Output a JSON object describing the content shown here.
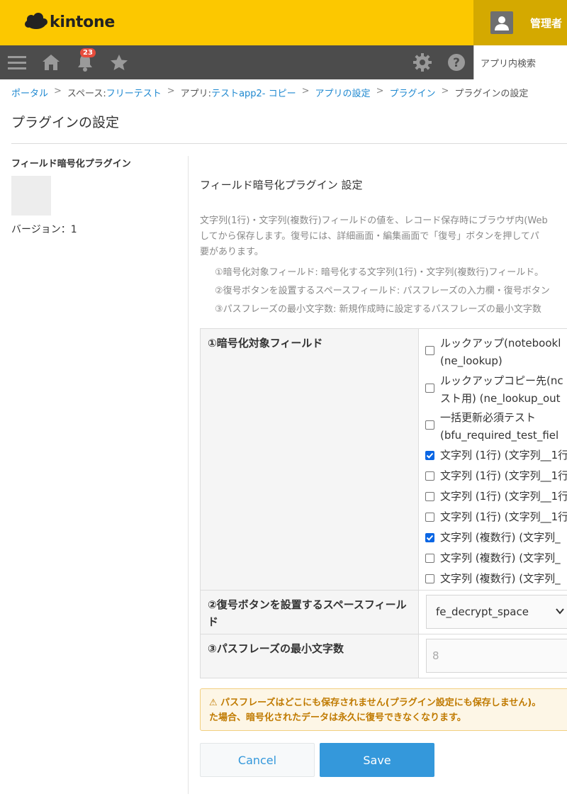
{
  "header": {
    "logo_text": "kintone",
    "user_name": "管理者"
  },
  "nav": {
    "notification_count": "23",
    "search_placeholder": "アプリ内検索"
  },
  "breadcrumb": {
    "portal": "ポータル",
    "space_prefix": "スペース: ",
    "space": "フリーテスト",
    "app_prefix": "アプリ: ",
    "app": "テストapp2- コピー",
    "app_settings": "アプリの設定",
    "plugins": "プラグイン",
    "current": "プラグインの設定",
    "separator": ">"
  },
  "page_title": "プラグインの設定",
  "plugin": {
    "name": "フィールド暗号化プラグイン",
    "version": "バージョン：1"
  },
  "settings": {
    "title": "フィールド暗号化プラグイン 設定",
    "description": [
      "文字列(1行)・文字列(複数行)フィールドの値を、レコード保存時にブラウザ内(Web",
      "してから保存します。復号には、詳細画面・編集画面で「復号」ボタンを押してパ",
      "要があります。"
    ],
    "items": [
      "①暗号化対象フィールド: 暗号化する文字列(1行)・文字列(複数行)フィールド。",
      "②復号ボタンを設置するスペースフィールド: パスフレーズの入力欄・復号ボタン",
      "③パスフレーズの最小文字数: 新規作成時に設定するパスフレーズの最小文字数"
    ]
  },
  "form": {
    "target_fields_label": "①暗号化対象フィールド",
    "fields": [
      {
        "line1": "ルックアップ(notebookl",
        "line2": "(ne_lookup)",
        "checked": false
      },
      {
        "line1": "ルックアップコピー先(nc",
        "line2": "スト用) (ne_lookup_out",
        "checked": false
      },
      {
        "line1": "一括更新必須テスト",
        "line2": "(bfu_required_test_fiel",
        "checked": false
      },
      {
        "line1": "文字列 (1行) (文字列__1行",
        "line2": "",
        "checked": true
      },
      {
        "line1": "文字列 (1行) (文字列__1行",
        "line2": "",
        "checked": false
      },
      {
        "line1": "文字列 (1行) (文字列__1行",
        "line2": "",
        "checked": false
      },
      {
        "line1": "文字列 (1行) (文字列__1行",
        "line2": "",
        "checked": false
      },
      {
        "line1": "文字列 (複数行) (文字列_",
        "line2": "",
        "checked": true
      },
      {
        "line1": "文字列 (複数行) (文字列_",
        "line2": "",
        "checked": false
      },
      {
        "line1": "文字列 (複数行) (文字列_",
        "line2": "",
        "checked": false
      }
    ],
    "space_field_label": "②復号ボタンを設置するスペースフィールド",
    "space_field_value": "fe_decrypt_space",
    "min_length_label": "③パスフレーズの最小文字数",
    "min_length_placeholder": "8"
  },
  "warning": {
    "line1": "⚠ パスフレーズはどこにも保存されません(プラグイン設定にも保存しません)。",
    "line2": "た場合、暗号化されたデータは永久に復号できなくなります。"
  },
  "buttons": {
    "cancel": "Cancel",
    "save": "Save"
  },
  "colors": {
    "header_bg": "#fcc800",
    "nav_bg": "#4c4c4c",
    "link": "#1e88d0",
    "save_button": "#3498db",
    "badge": "#e74c3c"
  }
}
